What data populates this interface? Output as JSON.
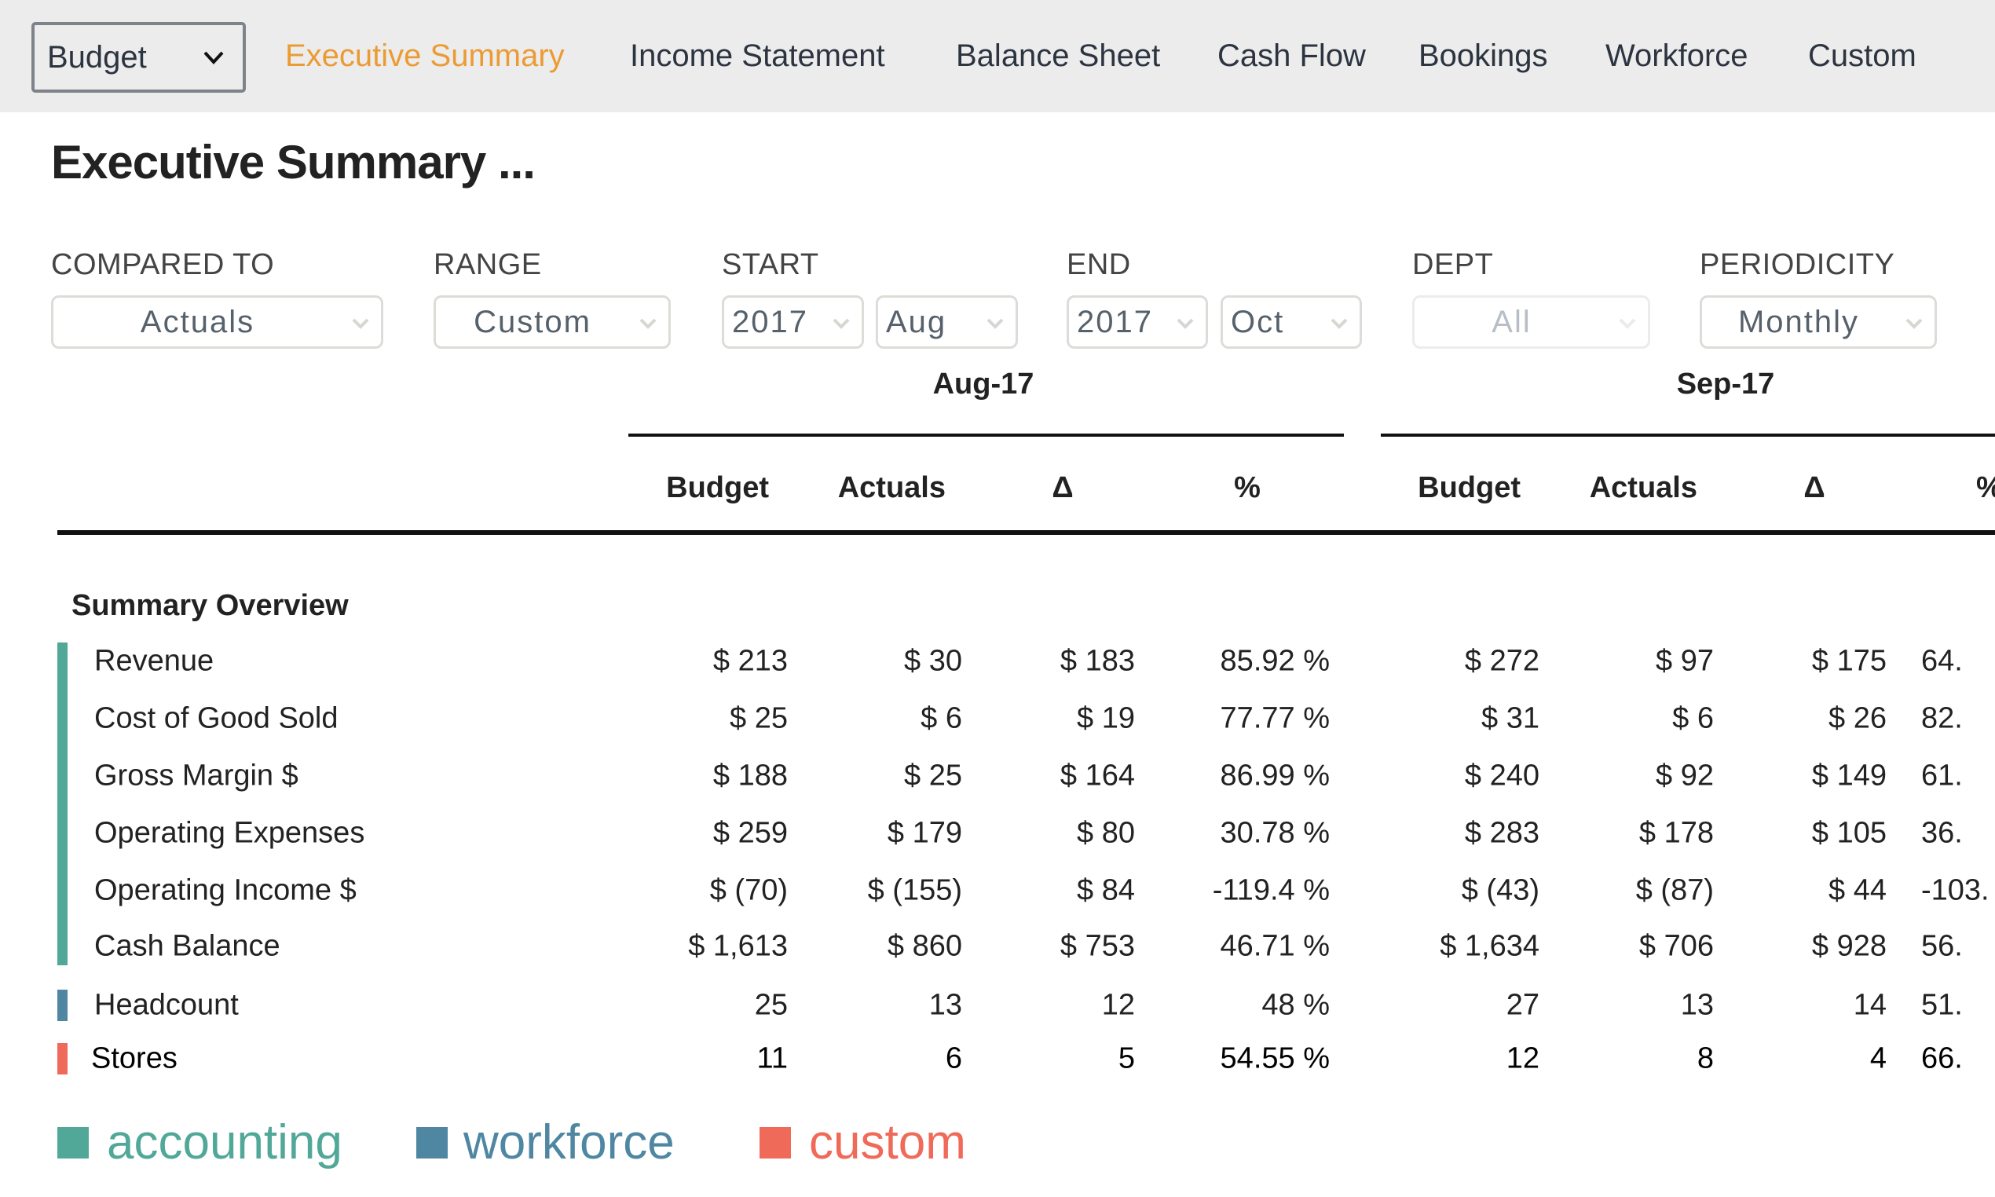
{
  "nav": {
    "scenario_select": "Budget",
    "items": [
      {
        "label": "Executive Summary",
        "active": true
      },
      {
        "label": "Income Statement",
        "active": false
      },
      {
        "label": "Balance Sheet",
        "active": false
      },
      {
        "label": "Cash Flow",
        "active": false
      },
      {
        "label": "Bookings",
        "active": false
      },
      {
        "label": "Workforce",
        "active": false
      },
      {
        "label": "Custom",
        "active": false
      }
    ]
  },
  "page_title": "Executive Summary ...",
  "filters": {
    "compared_to": {
      "label": "COMPARED TO",
      "value": "Actuals"
    },
    "range": {
      "label": "RANGE",
      "value": "Custom"
    },
    "start": {
      "label": "START",
      "year": "2017",
      "month": "Aug"
    },
    "end": {
      "label": "END",
      "year": "2017",
      "month": "Oct"
    },
    "dept": {
      "label": "DEPT",
      "value": "All",
      "disabled": true
    },
    "periodicity": {
      "label": "PERIODICITY",
      "value": "Monthly"
    }
  },
  "table": {
    "periods": [
      {
        "label": "Aug-17",
        "columns": [
          "Budget",
          "Actuals",
          "Δ",
          "%"
        ]
      },
      {
        "label": "Sep-17",
        "columns": [
          "Budget",
          "Actuals",
          "Δ",
          "%"
        ]
      }
    ],
    "section_title": "Summary Overview",
    "rows": [
      {
        "label": "Revenue",
        "category": "accounting",
        "values": [
          "$ 213",
          "$ 30",
          "$ 183",
          "85.92 %",
          "$ 272",
          "$ 97",
          "$ 175",
          "64."
        ]
      },
      {
        "label": "Cost of Good Sold",
        "category": "accounting",
        "values": [
          "$ 25",
          "$ 6",
          "$ 19",
          "77.77 %",
          "$ 31",
          "$ 6",
          "$ 26",
          "82."
        ]
      },
      {
        "label": "Gross Margin $",
        "category": "accounting",
        "values": [
          "$ 188",
          "$ 25",
          "$ 164",
          "86.99 %",
          "$ 240",
          "$ 92",
          "$ 149",
          "61."
        ]
      },
      {
        "label": "Operating Expenses",
        "category": "accounting",
        "values": [
          "$ 259",
          "$ 179",
          "$ 80",
          "30.78 %",
          "$ 283",
          "$ 178",
          "$ 105",
          "36."
        ]
      },
      {
        "label": "Operating Income $",
        "category": "accounting",
        "values": [
          "$ (70)",
          "$ (155)",
          "$ 84",
          "-119.4 %",
          "$ (43)",
          "$ (87)",
          "$ 44",
          "-103."
        ]
      },
      {
        "label": "Cash Balance",
        "category": "accounting",
        "values": [
          "$ 1,613",
          "$ 860",
          "$ 753",
          "46.71 %",
          "$ 1,634",
          "$ 706",
          "$ 928",
          "56."
        ]
      },
      {
        "label": "Headcount",
        "category": "workforce",
        "values": [
          "25",
          "13",
          "12",
          "48 %",
          "27",
          "13",
          "14",
          "51."
        ]
      },
      {
        "label": "Stores",
        "category": "custom",
        "values": [
          "11",
          "6",
          "5",
          "54.55 %",
          "12",
          "8",
          "4",
          "66."
        ]
      }
    ]
  },
  "legend": [
    {
      "label": "accounting",
      "color": "#52a898"
    },
    {
      "label": "workforce",
      "color": "#4f87a3"
    },
    {
      "label": "custom",
      "color": "#f06a59"
    }
  ],
  "colors": {
    "accent": "#eb9b34",
    "nav_bg": "#ececec",
    "accounting": "#52a898",
    "workforce": "#4f87a3",
    "custom": "#f06a59"
  }
}
